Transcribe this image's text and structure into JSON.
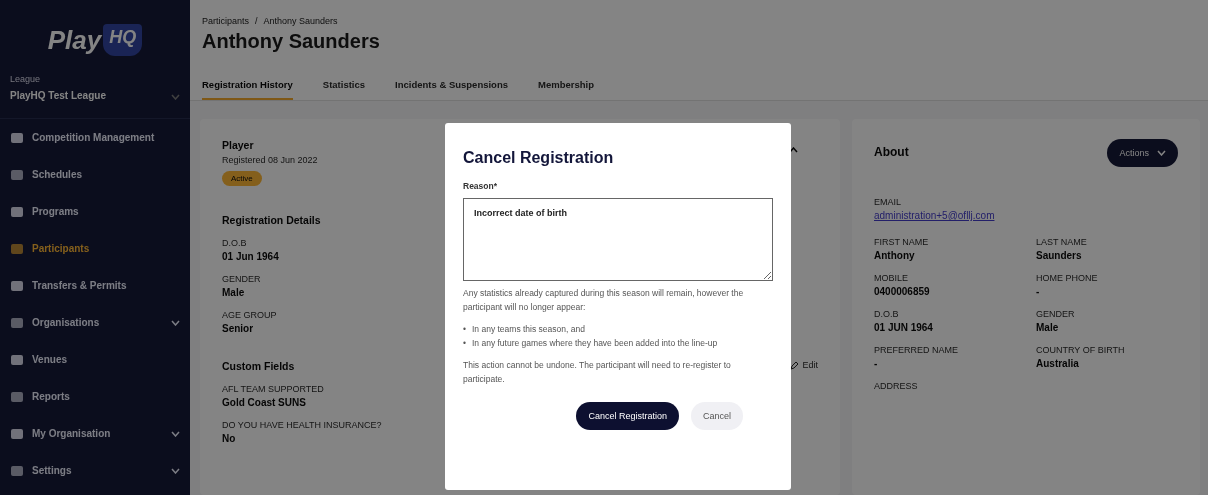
{
  "sidebar": {
    "logo": "Play",
    "logo_badge": "HQ",
    "org_label": "League",
    "org_name": "PlayHQ Test League",
    "items": [
      {
        "label": "Competition Management",
        "selected": false,
        "expandable": false
      },
      {
        "label": "Schedules",
        "selected": false,
        "expandable": false
      },
      {
        "label": "Programs",
        "selected": false,
        "expandable": false
      },
      {
        "label": "Participants",
        "selected": true,
        "expandable": false
      },
      {
        "label": "Transfers & Permits",
        "selected": false,
        "expandable": false
      },
      {
        "label": "Organisations",
        "selected": false,
        "expandable": true
      },
      {
        "label": "Venues",
        "selected": false,
        "expandable": false
      },
      {
        "label": "Reports",
        "selected": false,
        "expandable": false
      },
      {
        "label": "My Organisation",
        "selected": false,
        "expandable": true
      },
      {
        "label": "Settings",
        "selected": false,
        "expandable": true
      }
    ]
  },
  "breadcrumb": [
    "Participants",
    "Anthony Saunders"
  ],
  "breadcrumb_separator": "/",
  "title": "Anthony Saunders",
  "tabs": [
    {
      "label": "Registration History",
      "selected": true
    },
    {
      "label": "Statistics",
      "selected": false
    },
    {
      "label": "Incidents & Suspensions",
      "selected": false
    },
    {
      "label": "Membership",
      "selected": false
    }
  ],
  "registration": {
    "role": "Player",
    "registered": "Registered 08 Jun 2022",
    "status": "Active",
    "details_title": "Registration Details",
    "details": [
      {
        "label": "D.O.B",
        "value": "01 Jun 1964"
      },
      {
        "label": "GENDER",
        "value": "Male"
      },
      {
        "label": "AGE GROUP",
        "value": "Senior"
      }
    ],
    "custom_title": "Custom Fields",
    "edit": "Edit",
    "custom": [
      {
        "label": "AFL TEAM SUPPORTED",
        "value": "Gold Coast SUNS"
      },
      {
        "label": "DO YOU HAVE HEALTH INSURANCE?",
        "value": "No"
      }
    ]
  },
  "about": {
    "title": "About",
    "actions": "Actions",
    "email_label": "EMAIL",
    "email": "administration+5@ofllj.com",
    "fields": [
      {
        "label": "FIRST NAME",
        "value": "Anthony"
      },
      {
        "label": "LAST NAME",
        "value": "Saunders"
      },
      {
        "label": "MOBILE",
        "value": "0400006859"
      },
      {
        "label": "HOME PHONE",
        "value": "-"
      },
      {
        "label": "D.O.B",
        "value": "01 JUN 1964"
      },
      {
        "label": "GENDER",
        "value": "Male"
      },
      {
        "label": "PREFERRED NAME",
        "value": "-"
      },
      {
        "label": "COUNTRY OF BIRTH",
        "value": "Australia"
      },
      {
        "label": "ADDRESS"
      }
    ]
  },
  "modal": {
    "title": "Cancel Registration",
    "field_label": "Reason*",
    "value": "Incorrect date of birth",
    "intro": "Any statistics already captured during this season will remain, however the participant will no longer appear:",
    "bullet": "•",
    "bullets": [
      "In any teams this season, and",
      "In any future games where they have been added into the line-up"
    ],
    "warning": "This action cannot be undone. The participant will need to re-register to participate.",
    "buttons": [
      {
        "label": "Cancel Registration",
        "kind": "primary"
      },
      {
        "label": "Cancel",
        "kind": "secondary"
      }
    ]
  }
}
